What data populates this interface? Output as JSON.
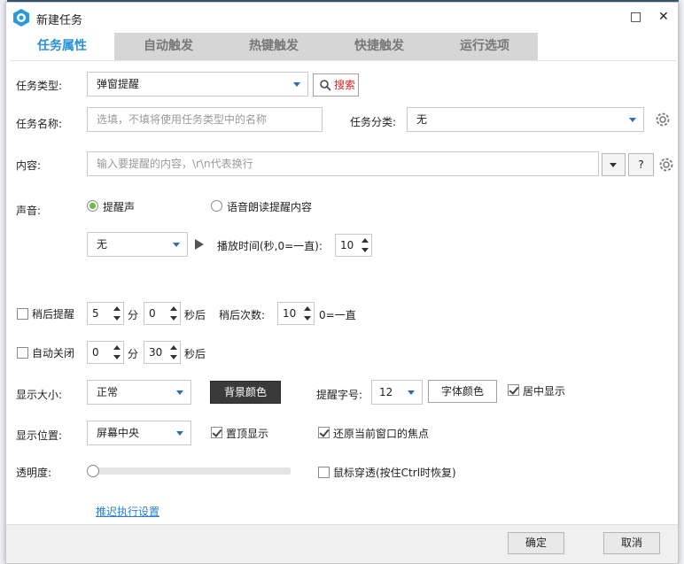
{
  "window": {
    "title": "新建任务",
    "maximize_glyph": "□",
    "close_glyph": "✕"
  },
  "tabs": [
    {
      "label": "任务属性"
    },
    {
      "label": "自动触发"
    },
    {
      "label": "热键触发"
    },
    {
      "label": "快捷触发"
    },
    {
      "label": "运行选项"
    }
  ],
  "task_type": {
    "label": "任务类型:",
    "value": "弹窗提醒",
    "search_label": "搜索"
  },
  "task_name": {
    "label": "任务名称:",
    "placeholder": "选填，不填将使用任务类型中的名称",
    "category_label": "任务分类:",
    "category_value": "无"
  },
  "content": {
    "label": "内容:",
    "placeholder": "输入要提醒的内容，\\r\\n代表换行",
    "help_label": "?"
  },
  "sound": {
    "label": "声音:",
    "option_beep": "提醒声",
    "option_tts": "语音朗读提醒内容",
    "sound_value": "无",
    "play_time_label": "播放时间(秒,0=一直):",
    "play_time_value": "10"
  },
  "remind_later": {
    "label": "稍后提醒",
    "minutes": "5",
    "min_unit": "分",
    "seconds": "0",
    "sec_unit": "秒后",
    "count_label": "稍后次数:",
    "count_value": "10",
    "count_hint": "0=一直"
  },
  "auto_close": {
    "label": "自动关闭",
    "minutes": "0",
    "min_unit": "分",
    "seconds": "30",
    "sec_unit": "秒后"
  },
  "display_size": {
    "label": "显示大小:",
    "value": "正常",
    "bg_color_button": "背景颜色",
    "font_size_label": "提醒字号:",
    "font_size_value": "12",
    "font_color_button": "字体颜色",
    "center_label": "居中显示"
  },
  "display_pos": {
    "label": "显示位置:",
    "value": "屏幕中央",
    "topmost_label": "置顶显示",
    "restore_focus_label": "还原当前窗口的焦点"
  },
  "opacity": {
    "label": "透明度:",
    "level": 0,
    "click_through_label": "鼠标穿透(按住Ctrl时恢复)"
  },
  "delay_link": "推迟执行设置",
  "footer": {
    "ok_label": "确定",
    "cancel_label": "取消"
  },
  "colors": {
    "accent": "#2a8fd6",
    "search_red": "#e02020",
    "radio_green": "#6abf3a",
    "dark_button": "#3a3a3a"
  }
}
